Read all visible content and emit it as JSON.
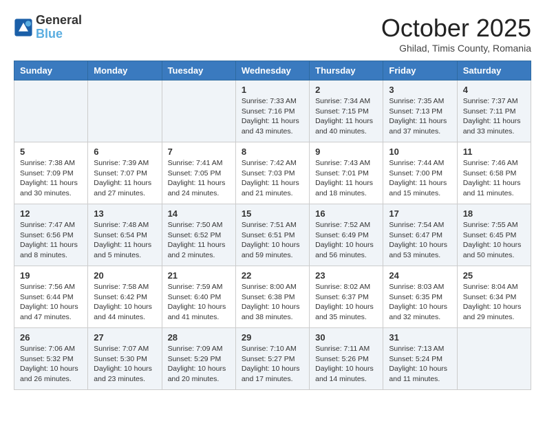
{
  "header": {
    "logo_line1": "General",
    "logo_line2": "Blue",
    "month": "October 2025",
    "location": "Ghilad, Timis County, Romania"
  },
  "weekdays": [
    "Sunday",
    "Monday",
    "Tuesday",
    "Wednesday",
    "Thursday",
    "Friday",
    "Saturday"
  ],
  "weeks": [
    [
      {
        "day": "",
        "info": ""
      },
      {
        "day": "",
        "info": ""
      },
      {
        "day": "",
        "info": ""
      },
      {
        "day": "1",
        "info": "Sunrise: 7:33 AM\nSunset: 7:16 PM\nDaylight: 11 hours\nand 43 minutes."
      },
      {
        "day": "2",
        "info": "Sunrise: 7:34 AM\nSunset: 7:15 PM\nDaylight: 11 hours\nand 40 minutes."
      },
      {
        "day": "3",
        "info": "Sunrise: 7:35 AM\nSunset: 7:13 PM\nDaylight: 11 hours\nand 37 minutes."
      },
      {
        "day": "4",
        "info": "Sunrise: 7:37 AM\nSunset: 7:11 PM\nDaylight: 11 hours\nand 33 minutes."
      }
    ],
    [
      {
        "day": "5",
        "info": "Sunrise: 7:38 AM\nSunset: 7:09 PM\nDaylight: 11 hours\nand 30 minutes."
      },
      {
        "day": "6",
        "info": "Sunrise: 7:39 AM\nSunset: 7:07 PM\nDaylight: 11 hours\nand 27 minutes."
      },
      {
        "day": "7",
        "info": "Sunrise: 7:41 AM\nSunset: 7:05 PM\nDaylight: 11 hours\nand 24 minutes."
      },
      {
        "day": "8",
        "info": "Sunrise: 7:42 AM\nSunset: 7:03 PM\nDaylight: 11 hours\nand 21 minutes."
      },
      {
        "day": "9",
        "info": "Sunrise: 7:43 AM\nSunset: 7:01 PM\nDaylight: 11 hours\nand 18 minutes."
      },
      {
        "day": "10",
        "info": "Sunrise: 7:44 AM\nSunset: 7:00 PM\nDaylight: 11 hours\nand 15 minutes."
      },
      {
        "day": "11",
        "info": "Sunrise: 7:46 AM\nSunset: 6:58 PM\nDaylight: 11 hours\nand 11 minutes."
      }
    ],
    [
      {
        "day": "12",
        "info": "Sunrise: 7:47 AM\nSunset: 6:56 PM\nDaylight: 11 hours\nand 8 minutes."
      },
      {
        "day": "13",
        "info": "Sunrise: 7:48 AM\nSunset: 6:54 PM\nDaylight: 11 hours\nand 5 minutes."
      },
      {
        "day": "14",
        "info": "Sunrise: 7:50 AM\nSunset: 6:52 PM\nDaylight: 11 hours\nand 2 minutes."
      },
      {
        "day": "15",
        "info": "Sunrise: 7:51 AM\nSunset: 6:51 PM\nDaylight: 10 hours\nand 59 minutes."
      },
      {
        "day": "16",
        "info": "Sunrise: 7:52 AM\nSunset: 6:49 PM\nDaylight: 10 hours\nand 56 minutes."
      },
      {
        "day": "17",
        "info": "Sunrise: 7:54 AM\nSunset: 6:47 PM\nDaylight: 10 hours\nand 53 minutes."
      },
      {
        "day": "18",
        "info": "Sunrise: 7:55 AM\nSunset: 6:45 PM\nDaylight: 10 hours\nand 50 minutes."
      }
    ],
    [
      {
        "day": "19",
        "info": "Sunrise: 7:56 AM\nSunset: 6:44 PM\nDaylight: 10 hours\nand 47 minutes."
      },
      {
        "day": "20",
        "info": "Sunrise: 7:58 AM\nSunset: 6:42 PM\nDaylight: 10 hours\nand 44 minutes."
      },
      {
        "day": "21",
        "info": "Sunrise: 7:59 AM\nSunset: 6:40 PM\nDaylight: 10 hours\nand 41 minutes."
      },
      {
        "day": "22",
        "info": "Sunrise: 8:00 AM\nSunset: 6:38 PM\nDaylight: 10 hours\nand 38 minutes."
      },
      {
        "day": "23",
        "info": "Sunrise: 8:02 AM\nSunset: 6:37 PM\nDaylight: 10 hours\nand 35 minutes."
      },
      {
        "day": "24",
        "info": "Sunrise: 8:03 AM\nSunset: 6:35 PM\nDaylight: 10 hours\nand 32 minutes."
      },
      {
        "day": "25",
        "info": "Sunrise: 8:04 AM\nSunset: 6:34 PM\nDaylight: 10 hours\nand 29 minutes."
      }
    ],
    [
      {
        "day": "26",
        "info": "Sunrise: 7:06 AM\nSunset: 5:32 PM\nDaylight: 10 hours\nand 26 minutes."
      },
      {
        "day": "27",
        "info": "Sunrise: 7:07 AM\nSunset: 5:30 PM\nDaylight: 10 hours\nand 23 minutes."
      },
      {
        "day": "28",
        "info": "Sunrise: 7:09 AM\nSunset: 5:29 PM\nDaylight: 10 hours\nand 20 minutes."
      },
      {
        "day": "29",
        "info": "Sunrise: 7:10 AM\nSunset: 5:27 PM\nDaylight: 10 hours\nand 17 minutes."
      },
      {
        "day": "30",
        "info": "Sunrise: 7:11 AM\nSunset: 5:26 PM\nDaylight: 10 hours\nand 14 minutes."
      },
      {
        "day": "31",
        "info": "Sunrise: 7:13 AM\nSunset: 5:24 PM\nDaylight: 10 hours\nand 11 minutes."
      },
      {
        "day": "",
        "info": ""
      }
    ]
  ]
}
